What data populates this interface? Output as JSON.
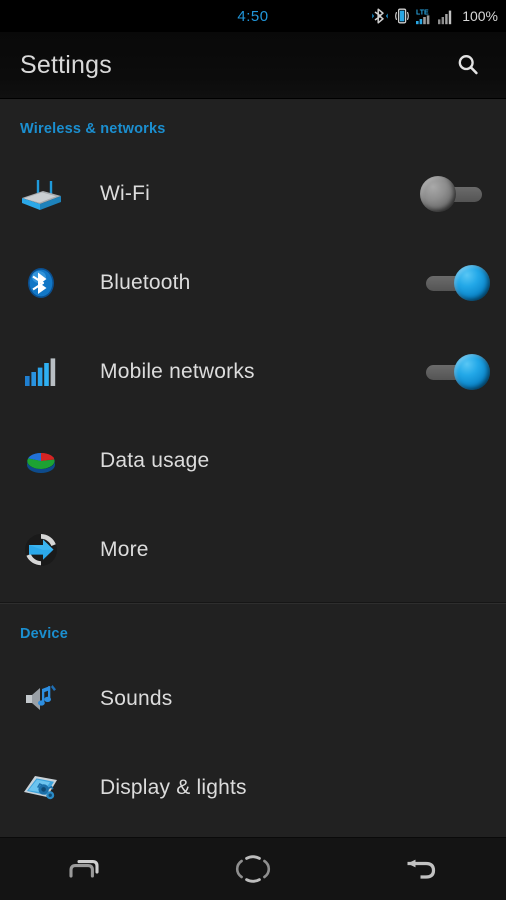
{
  "status_bar": {
    "clock": "4:50",
    "battery_text": "100%",
    "icons": [
      "bluetooth-icon",
      "vibrate-icon",
      "lte-signal-icon",
      "signal-bars-icon"
    ],
    "clock_color": "#2196d9"
  },
  "action_bar": {
    "title": "Settings",
    "search_icon": "search-icon"
  },
  "accent_color": "#1b8fd0",
  "sections": [
    {
      "header": "Wireless & networks",
      "rows": [
        {
          "label": "Wi-Fi",
          "icon": "wifi-router-icon",
          "toggle": "off"
        },
        {
          "label": "Bluetooth",
          "icon": "bluetooth-icon",
          "toggle": "on"
        },
        {
          "label": "Mobile networks",
          "icon": "signal-bars-icon",
          "toggle": "on"
        },
        {
          "label": "Data usage",
          "icon": "pie-chart-icon",
          "toggle": "none"
        },
        {
          "label": "More",
          "icon": "arrow-circle-icon",
          "toggle": "none"
        }
      ]
    },
    {
      "header": "Device",
      "rows": [
        {
          "label": "Sounds",
          "icon": "speaker-notes-icon",
          "toggle": "none"
        },
        {
          "label": "Display & lights",
          "icon": "display-gear-icon",
          "toggle": "none"
        }
      ]
    }
  ],
  "nav_bar": {
    "buttons": [
      {
        "name": "recents-icon"
      },
      {
        "name": "home-icon"
      },
      {
        "name": "back-icon"
      }
    ]
  }
}
